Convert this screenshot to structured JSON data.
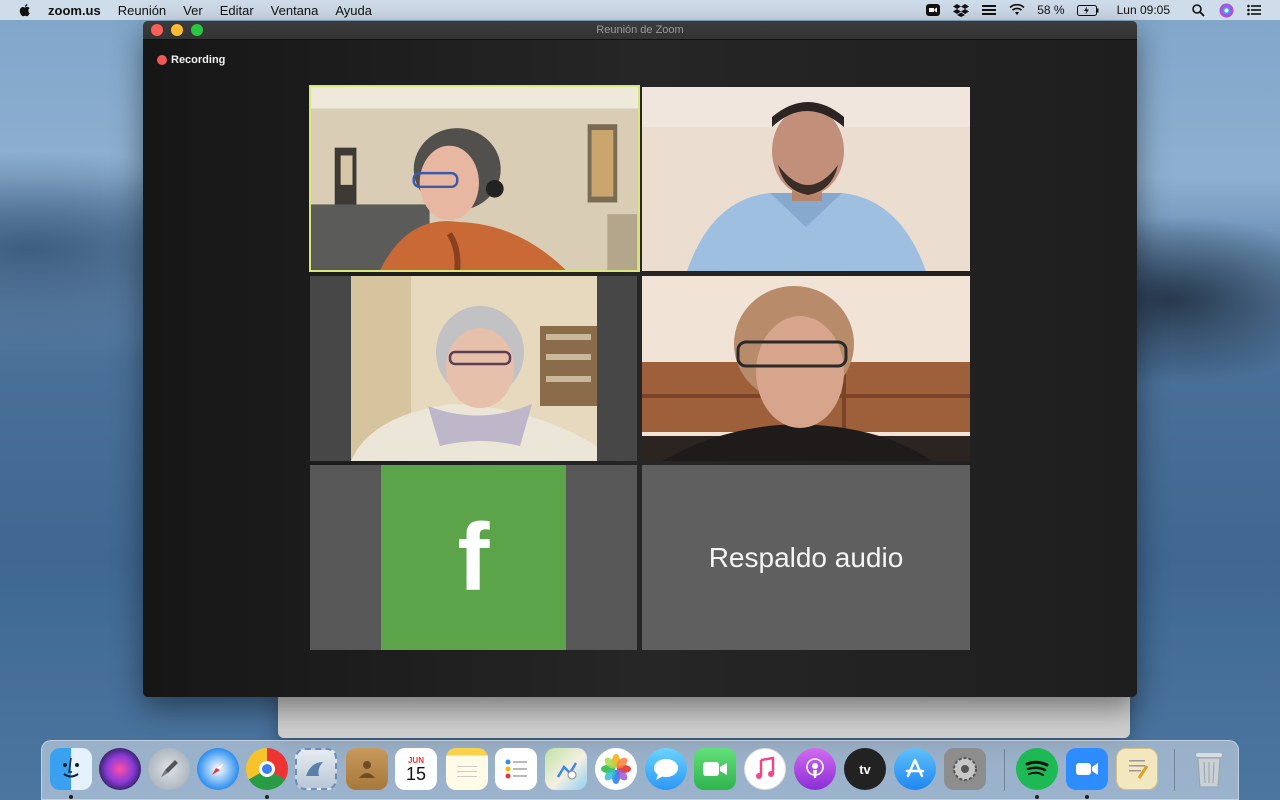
{
  "menubar": {
    "app_name": "zoom.us",
    "menus": [
      "Reunión",
      "Ver",
      "Editar",
      "Ventana",
      "Ayuda"
    ],
    "battery": "58 %",
    "clock": "Lun 09:05"
  },
  "window": {
    "title": "Reunión de Zoom",
    "recording_label": "Recording"
  },
  "tiles": {
    "facebook_letter": "f",
    "audio_backup": "Respaldo audio"
  },
  "dock": {
    "calendar_month": "JUN",
    "calendar_day": "15",
    "tv_label": "tv"
  }
}
